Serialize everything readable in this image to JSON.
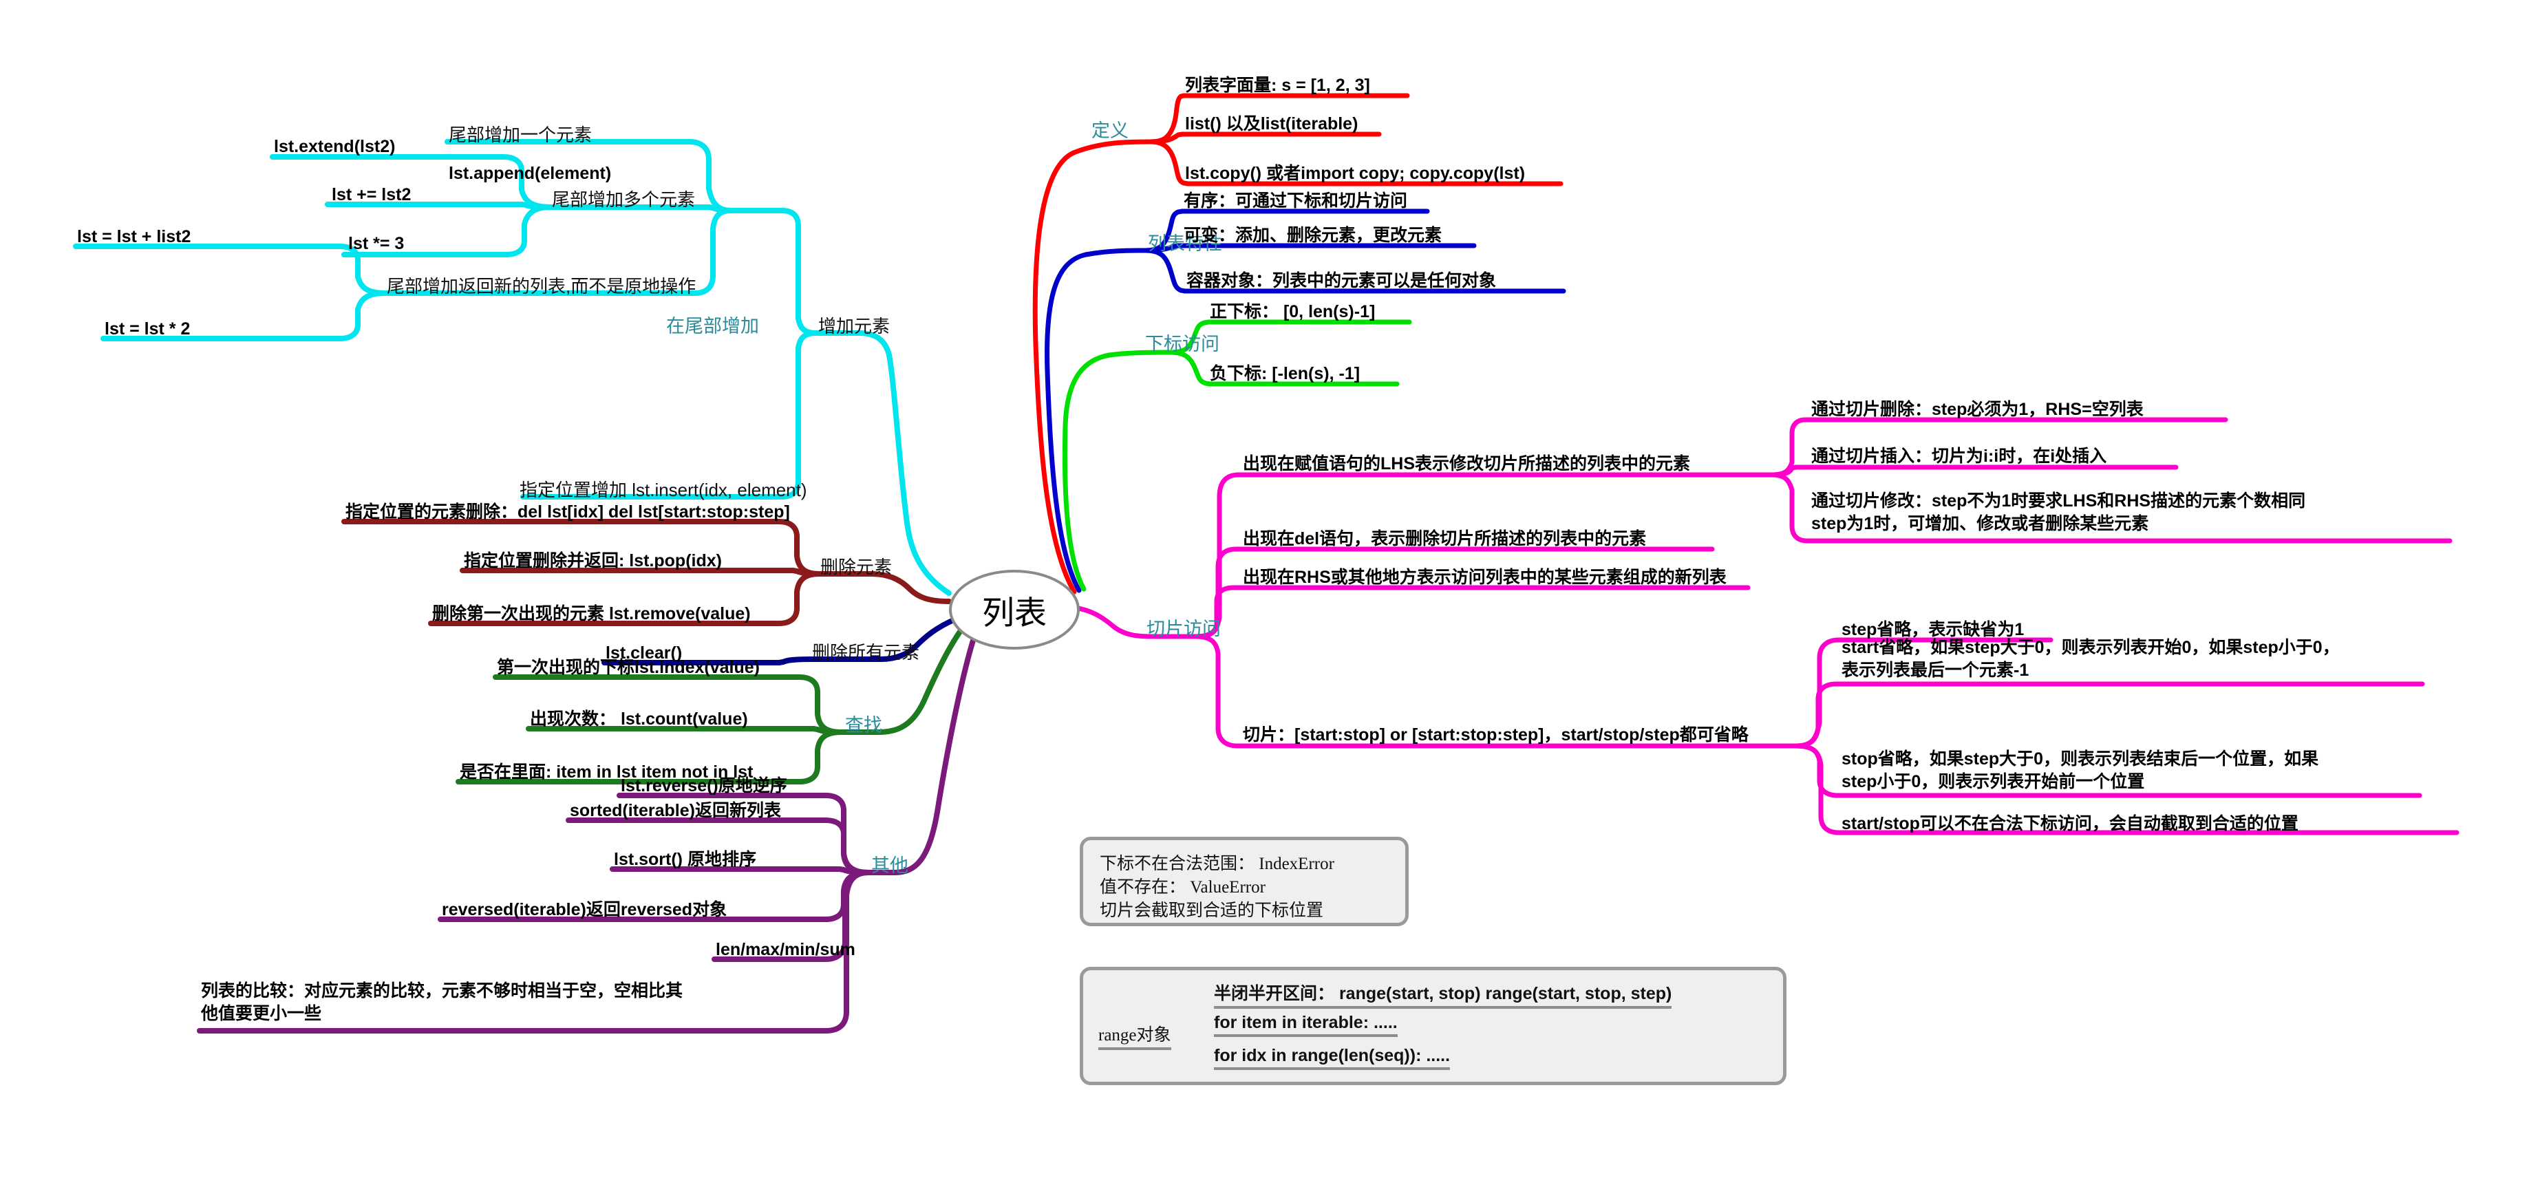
{
  "title": "列表",
  "colors": {
    "define": "#ff0000",
    "features": "#0000cc",
    "index_access": "#00e000",
    "slice_access": "#ff00cc",
    "add_element": "#00e5ee",
    "del_element": "#8b1a1a",
    "del_all": "#00008b",
    "search": "#1e7a1e",
    "other": "#7b1a7b",
    "branch_label": "#2b8a9b",
    "center_border": "#8a8a8a",
    "box_border": "#9a9a9a",
    "box_fill": "#efefef"
  },
  "branches": {
    "define": {
      "label": "定义",
      "items": [
        "列表字面量: s = [1, 2, 3]",
        "list() 以及list(iterable)",
        "lst.copy() 或者import copy; copy.copy(lst)"
      ]
    },
    "features": {
      "label": "列表特性",
      "items": [
        "有序：可通过下标和切片访问",
        "可变：添加、删除元素，更改元素",
        "容器对象：列表中的元素可以是任何对象"
      ]
    },
    "index_access": {
      "label": "下标访问",
      "items": [
        "正下标： [0, len(s)-1]",
        "负下标: [-len(s), -1]"
      ]
    },
    "slice_access": {
      "label": "切片访问",
      "items": [
        {
          "text": "出现在赋值语句的LHS表示修改切片所描述的列表中的元素",
          "children": [
            "通过切片删除：step必须为1，RHS=空列表",
            "通过切片插入：切片为i:i时，在i处插入",
            "通过切片修改：step不为1时要求LHS和RHS描述的元素个数相同\nstep为1时，可增加、修改或者删除某些元素"
          ]
        },
        {
          "text": "出现在del语句，表示删除切片所描述的列表中的元素",
          "children": []
        },
        {
          "text": "出现在RHS或其他地方表示访问列表中的某些元素组成的新列表",
          "children": []
        },
        {
          "text": "切片：[start:stop] or [start:stop:step]，start/stop/step都可省略",
          "children": [
            "step省略，表示缺省为1",
            "start省略，如果step大于0，则表示列表开始0，如果step小于0，\n表示列表最后一个元素-1",
            "stop省略，如果step大于0，则表示列表结束后一个位置，如果\nstep小于0，则表示列表开始前一个位置",
            "start/stop可以不在合法下标访问，会自动截取到合适的位置"
          ]
        }
      ]
    },
    "add_element": {
      "label": "增加元素",
      "sub_tail": {
        "label": "在尾部增加",
        "groups": [
          {
            "label": "尾部增加一个元素",
            "items": [
              "lst.append(element)"
            ]
          },
          {
            "label": "尾部增加多个元素",
            "items": [
              "lst.extend(lst2)",
              "lst += lst2",
              "lst *= 3"
            ]
          },
          {
            "label": "尾部增加返回新的列表,而不是原地操作",
            "items": [
              "lst = lst + list2",
              "lst = lst * 2"
            ]
          }
        ]
      },
      "insert": "指定位置增加 lst.insert(idx, element)"
    },
    "del_element": {
      "label": "删除元素",
      "items": [
        "指定位置的元素删除：del lst[idx]  del lst[start:stop:step]",
        "指定位置删除并返回: lst.pop(idx)",
        "删除第一次出现的元素 lst.remove(value)"
      ]
    },
    "del_all": {
      "label": "删除所有元素",
      "items": [
        "lst.clear()"
      ]
    },
    "search": {
      "label": "查找",
      "items": [
        "第一次出现的下标lst.index(value)",
        "出现次数： lst.count(value)",
        "是否在里面: item in lst  item not in lst"
      ]
    },
    "other": {
      "label": "其他",
      "items": [
        "lst.reverse()原地逆序",
        "sorted(iterable)返回新列表",
        "lst.sort()  原地排序",
        "reversed(iterable)返回reversed对象",
        "len/max/min/sum",
        "列表的比较：对应元素的比较，元素不够时相当于空，空相比其\n他值要更小一些"
      ]
    }
  },
  "boxes": {
    "errors": {
      "lines": [
        "下标不在合法范围： IndexError",
        "值不存在： ValueError",
        "切片会截取到合适的下标位置"
      ]
    },
    "range": {
      "label": "range对象",
      "lines": [
        "半闭半开区间： range(start, stop) range(start, stop, step)",
        "for item in iterable: .....",
        "for idx in range(len(seq)): ....."
      ]
    }
  }
}
